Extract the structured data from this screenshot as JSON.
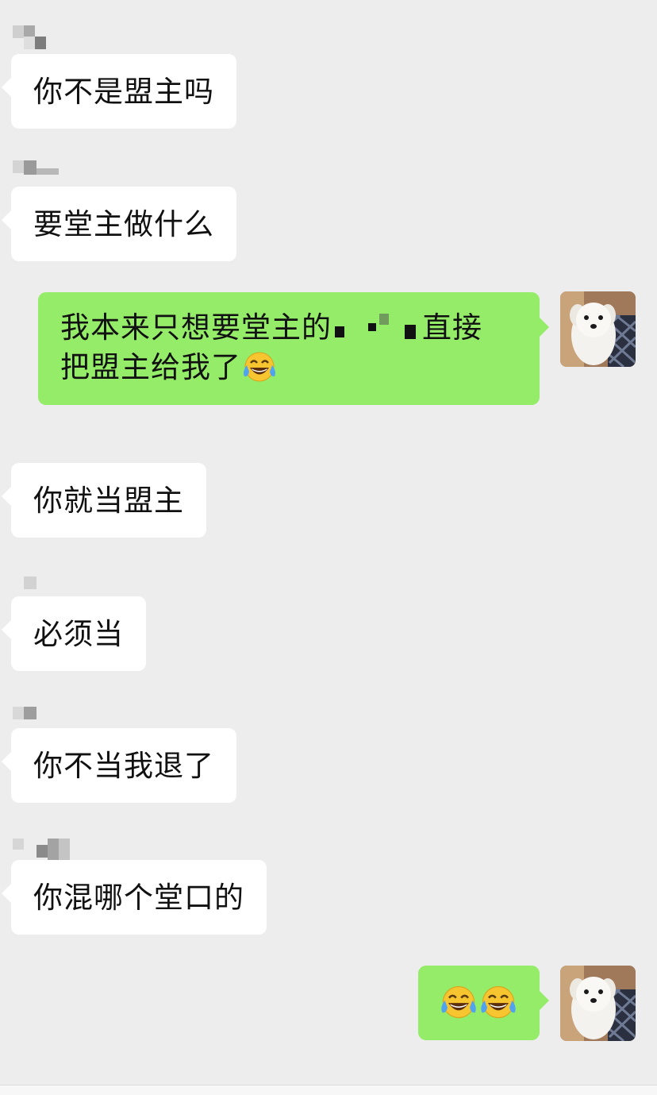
{
  "messages": [
    {
      "direction": "in",
      "sender": "",
      "text": "你不是盟主吗"
    },
    {
      "direction": "in",
      "sender": "",
      "text": "要堂主做什么"
    },
    {
      "direction": "out",
      "text_before": "我本来只想要堂主的",
      "text_after": "直接",
      "line2": "把盟主给我了",
      "emoji": "face-with-tears-of-joy"
    },
    {
      "direction": "in",
      "sender": "",
      "text": "你就当盟主"
    },
    {
      "direction": "in",
      "sender": "",
      "text": "必须当"
    },
    {
      "direction": "in",
      "sender": "",
      "text": "你不当我退了"
    },
    {
      "direction": "in",
      "sender": "",
      "text": "你混哪个堂口的"
    },
    {
      "direction": "out",
      "emoji": "face-with-tears-of-joy",
      "emoji_count": 2
    }
  ],
  "colors": {
    "background": "#ededed",
    "incoming_bubble": "#ffffff",
    "outgoing_bubble": "#95ec69",
    "text": "#111111"
  },
  "avatar": {
    "icon": "white-dog-avatar-icon"
  }
}
